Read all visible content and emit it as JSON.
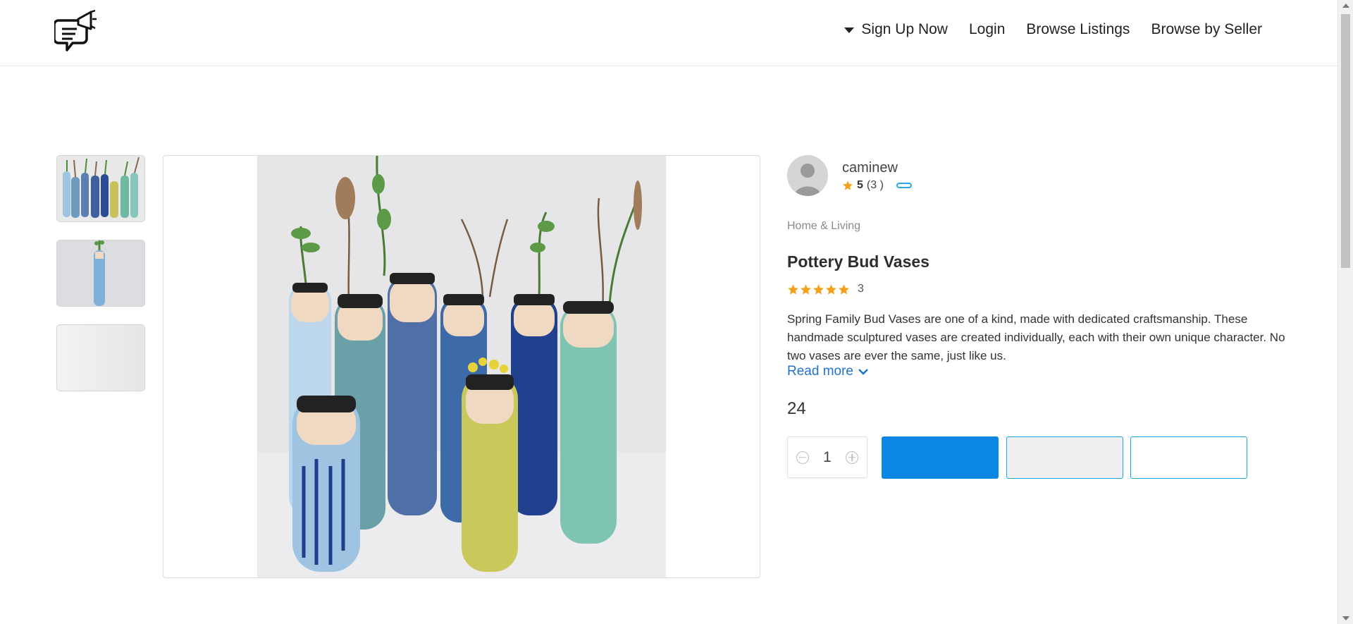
{
  "header": {
    "logo_icon": "megaphone-chat-icon",
    "nav": [
      {
        "label": "Sign Up Now",
        "has_caret": true
      },
      {
        "label": "Login"
      },
      {
        "label": "Browse Listings"
      },
      {
        "label": "Browse by Seller"
      }
    ]
  },
  "gallery": {
    "thumbnails": [
      "thumbnail-1",
      "thumbnail-2",
      "thumbnail-3"
    ],
    "main_image": "pottery-bud-vases-photo"
  },
  "seller": {
    "name": "caminew",
    "rating": "5",
    "reviews": "(3 )"
  },
  "product": {
    "category": "Home & Living",
    "title": "Pottery Bud Vases",
    "rating_stars": 5,
    "rating_count": "3",
    "description": "Spring Family Bud Vases are one of a kind, made with dedicated craftsmanship. These handmade sculptured vases are created individually, each with their own unique character. No two vases are ever the same, just like us.",
    "read_more": "Read more",
    "price": "24",
    "quantity": "1"
  },
  "colors": {
    "accent": "#0a86e3",
    "star": "#f4a21d",
    "link": "#1f74d0",
    "outline": "#15a7e6"
  }
}
